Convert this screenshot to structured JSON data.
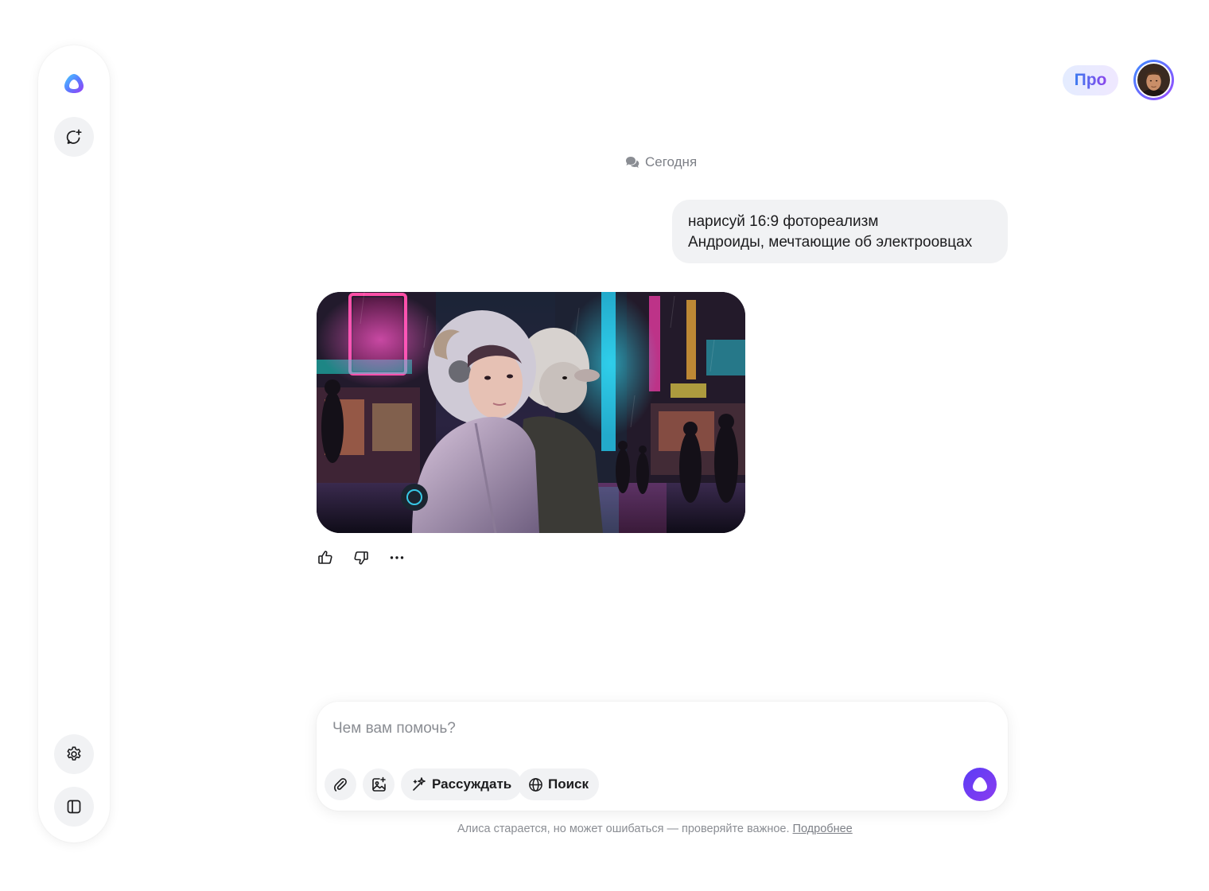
{
  "sidebar": {
    "logo_icon": "alice-logo-icon",
    "new_chat_icon": "new-chat-icon",
    "settings_icon": "gear-icon",
    "panel_icon": "sidebar-panel-icon"
  },
  "header": {
    "pro_label": "Про",
    "avatar_icon": "user-avatar"
  },
  "chat": {
    "date_label": "Сегодня",
    "date_icon": "chat-bubbles-icon",
    "user_message": {
      "line1": "нарисуй 16:9 фотореализм",
      "line2": "Андроиды, мечтающие об электроовцах"
    },
    "reactions": {
      "like_icon": "thumbs-up-icon",
      "dislike_icon": "thumbs-down-icon",
      "more_icon": "more-horizontal-icon"
    }
  },
  "composer": {
    "placeholder": "Чем вам помочь?",
    "value": "",
    "attach_icon": "paperclip-icon",
    "image_icon": "image-add-icon",
    "reason_label": "Рассуждать",
    "search_label": "Поиск",
    "send_icon": "alice-send-icon"
  },
  "footer": {
    "disclaimer": "Алиса старается, но может ошибаться — проверяйте важное.",
    "more_link": "Подробнее"
  },
  "colors": {
    "accent": "#6a3cf2",
    "bubble_bg": "#f1f2f4",
    "muted_text": "#8a8d93"
  }
}
